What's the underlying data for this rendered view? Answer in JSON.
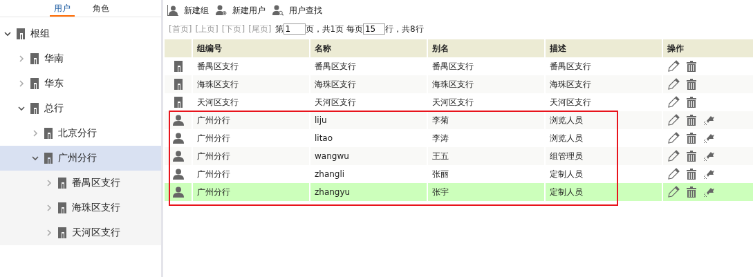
{
  "sidebar": {
    "tabs": [
      {
        "label": "用户",
        "selected": true
      },
      {
        "label": "角色",
        "selected": false
      }
    ],
    "tree": [
      {
        "label": "根组",
        "expanded": true,
        "selected": false,
        "children": [
          {
            "label": "华南",
            "expanded": false,
            "selected": false
          },
          {
            "label": "华东",
            "expanded": false,
            "selected": false
          },
          {
            "label": "总行",
            "expanded": true,
            "selected": false,
            "children": [
              {
                "label": "北京分行",
                "expanded": false,
                "selected": false
              },
              {
                "label": "广州分行",
                "expanded": true,
                "selected": true,
                "children": [
                  {
                    "label": "番禺区支行",
                    "expanded": false,
                    "selected": false
                  },
                  {
                    "label": "海珠区支行",
                    "expanded": false,
                    "selected": false
                  },
                  {
                    "label": "天河区支行",
                    "expanded": false,
                    "selected": false
                  }
                ]
              }
            ]
          }
        ]
      }
    ]
  },
  "toolbar": [
    {
      "kind": "group",
      "label": "新建组"
    },
    {
      "kind": "user",
      "label": "新建用户"
    },
    {
      "kind": "search",
      "label": "用户查找"
    }
  ],
  "pager": {
    "links": [
      "[首页]",
      "[上页]",
      "[下页]",
      "[尾页]"
    ],
    "page_prefix": "第",
    "page": "1",
    "page_suffix": "页，共1页 每页",
    "per_page": "15",
    "total": "行，共8行"
  },
  "table": {
    "columns": [
      "组编号",
      "名称",
      "别名",
      "描述",
      "操作"
    ],
    "rows": [
      {
        "kind": "group",
        "cells": [
          "番禺区支行",
          "番禺区支行",
          "番禺区支行",
          "番禺区支行"
        ],
        "selected": false
      },
      {
        "kind": "group",
        "cells": [
          "海珠区支行",
          "海珠区支行",
          "海珠区支行",
          "海珠区支行"
        ],
        "selected": false
      },
      {
        "kind": "group",
        "cells": [
          "天河区支行",
          "天河区支行",
          "天河区支行",
          "天河区支行"
        ],
        "selected": false
      },
      {
        "kind": "user",
        "cells": [
          "广州分行",
          "liju",
          "李菊",
          "浏览人员"
        ],
        "selected": false
      },
      {
        "kind": "user",
        "cells": [
          "广州分行",
          "litao",
          "李涛",
          "浏览人员"
        ],
        "selected": false
      },
      {
        "kind": "user",
        "cells": [
          "广州分行",
          "wangwu",
          "王五",
          "组管理员"
        ],
        "selected": false
      },
      {
        "kind": "user",
        "cells": [
          "广州分行",
          "zhangli",
          "张丽",
          "定制人员"
        ],
        "selected": false
      },
      {
        "kind": "user",
        "cells": [
          "广州分行",
          "zhangyu",
          "张宇",
          "定制人员"
        ],
        "selected": true
      }
    ],
    "annotation": {
      "kind": "rectangle"
    }
  }
}
